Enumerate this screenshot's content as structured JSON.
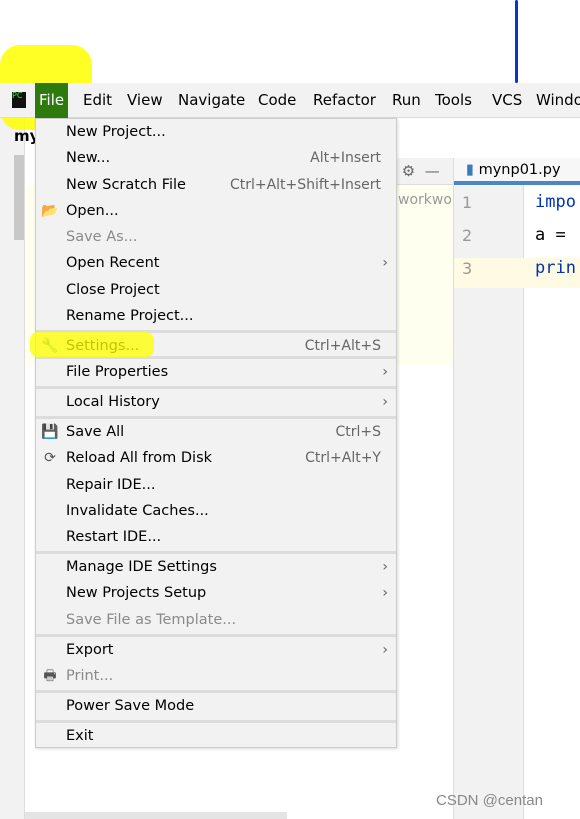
{
  "menubar": [
    "File",
    "Edit",
    "View",
    "Navigate",
    "Code",
    "Refactor",
    "Run",
    "Tools",
    "VCS",
    "Windo"
  ],
  "project_label": "my",
  "editor": {
    "tab": "mynp01.py",
    "crumb": "workwo",
    "lines": [
      "1",
      "2",
      "3"
    ],
    "code": [
      "impo",
      "a =",
      "prin"
    ]
  },
  "menu": [
    {
      "label": "New Project..."
    },
    {
      "label": "New...",
      "shortcut": "Alt+Insert"
    },
    {
      "label": "New Scratch File",
      "shortcut": "Ctrl+Alt+Shift+Insert"
    },
    {
      "label": "Open...",
      "icon": "folder-icon"
    },
    {
      "label": "Save As...",
      "disabled": true
    },
    {
      "label": "Open Recent",
      "submenu": true
    },
    {
      "label": "Close Project"
    },
    {
      "label": "Rename Project..."
    },
    {
      "label": "Settings...",
      "shortcut": "Ctrl+Alt+S",
      "icon": "wrench-icon"
    },
    {
      "label": "File Properties",
      "submenu": true
    },
    {
      "label": "Local History",
      "submenu": true
    },
    {
      "label": "Save All",
      "shortcut": "Ctrl+S",
      "icon": "save-icon"
    },
    {
      "label": "Reload All from Disk",
      "shortcut": "Ctrl+Alt+Y",
      "icon": "reload-icon"
    },
    {
      "label": "Repair IDE..."
    },
    {
      "label": "Invalidate Caches..."
    },
    {
      "label": "Restart IDE..."
    },
    {
      "label": "Manage IDE Settings",
      "submenu": true
    },
    {
      "label": "New Projects Setup",
      "submenu": true
    },
    {
      "label": "Save File as Template...",
      "disabled": true
    },
    {
      "label": "Export",
      "submenu": true
    },
    {
      "label": "Print...",
      "disabled": true,
      "icon": "printer-icon"
    },
    {
      "label": "Power Save Mode"
    },
    {
      "label": "Exit"
    }
  ],
  "watermark": "CSDN @centan",
  "colors": {
    "file_active": "#2e7a0f",
    "highlight": "#ffff00",
    "editor_tab_accent": "#4a86c8",
    "keyword": "#0033b3"
  }
}
